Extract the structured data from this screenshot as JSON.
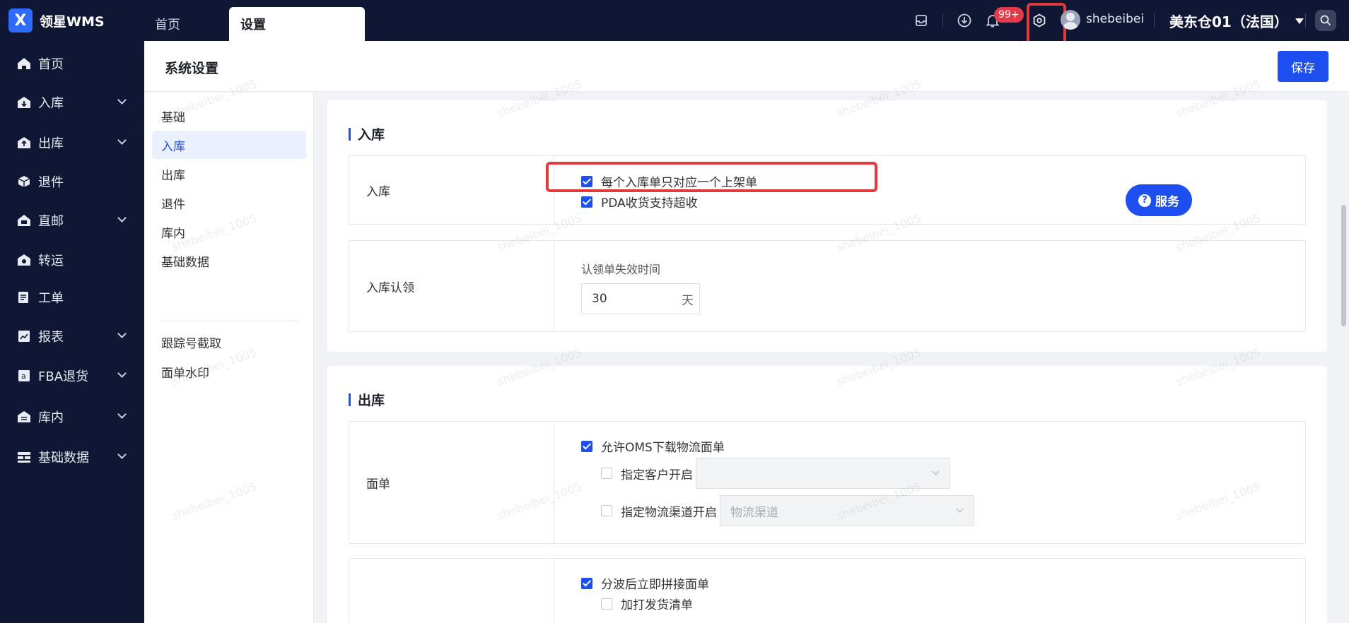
{
  "app": {
    "logo_letter": "X",
    "name": "领星WMS"
  },
  "tabs": [
    {
      "label": "首页"
    },
    {
      "label": "设置"
    }
  ],
  "topbar": {
    "notification_badge": "99+",
    "username": "shebeibei",
    "warehouse": "美东仓01（法国）",
    "icons": [
      "inbox-icon",
      "download-icon",
      "bell-icon",
      "settings-gear-icon",
      "user-avatar",
      "search-icon"
    ]
  },
  "sidebar": {
    "items": [
      {
        "label": "首页",
        "icon": "home-icon",
        "expandable": false
      },
      {
        "label": "入库",
        "icon": "inbound-icon",
        "expandable": true
      },
      {
        "label": "出库",
        "icon": "outbound-icon",
        "expandable": true
      },
      {
        "label": "退件",
        "icon": "return-icon",
        "expandable": false
      },
      {
        "label": "直邮",
        "icon": "direct-mail-icon",
        "expandable": true
      },
      {
        "label": "转运",
        "icon": "transfer-icon",
        "expandable": false
      },
      {
        "label": "工单",
        "icon": "work-order-icon",
        "expandable": false
      },
      {
        "label": "报表",
        "icon": "report-icon",
        "expandable": true
      },
      {
        "label": "FBA退货",
        "icon": "fba-return-icon",
        "expandable": true
      },
      {
        "label": "库内",
        "icon": "warehouse-icon",
        "expandable": true
      },
      {
        "label": "基础数据",
        "icon": "base-data-icon",
        "expandable": true
      }
    ]
  },
  "page": {
    "title": "系统设置",
    "save_label": "保存"
  },
  "subnav": {
    "items": [
      {
        "label": "基础",
        "active": false
      },
      {
        "label": "入库",
        "active": true
      },
      {
        "label": "出库",
        "active": false
      },
      {
        "label": "退件",
        "active": false
      },
      {
        "label": "库内",
        "active": false
      },
      {
        "label": "基础数据",
        "active": false
      }
    ],
    "extra_items": [
      {
        "label": "跟踪号截取"
      },
      {
        "label": "面单水印"
      }
    ]
  },
  "inbound": {
    "title": "入库",
    "row1": {
      "label": "入库",
      "options": [
        {
          "label": "每个入库单只对应一个上架单",
          "checked": true
        },
        {
          "label": "PDA收货支持超收",
          "checked": true
        }
      ]
    },
    "row2": {
      "label": "入库认领",
      "field_label": "认领单失效时间",
      "field_value": "30",
      "field_unit": "天"
    }
  },
  "outbound": {
    "title": "出库",
    "row1": {
      "label": "面单",
      "option": {
        "label": "允许OMS下载物流面单",
        "checked": true
      },
      "sub_options": [
        {
          "label": "指定客户开启",
          "checked": false,
          "select_placeholder": ""
        },
        {
          "label": "指定物流渠道开启",
          "checked": false,
          "select_placeholder": "物流渠道"
        }
      ]
    },
    "row2": {
      "options": [
        {
          "label": "分波后立即拼接面单",
          "checked": true
        },
        {
          "label": "加打发货清单",
          "checked": false
        }
      ]
    }
  },
  "service_button": {
    "icon": "?",
    "label": "服务"
  },
  "watermark": "shebeibei_1005",
  "colors": {
    "nav_bg": "#0f1735",
    "primary": "#1d4ff0",
    "highlight": "#e23b3b",
    "badge": "#e33b4a"
  }
}
